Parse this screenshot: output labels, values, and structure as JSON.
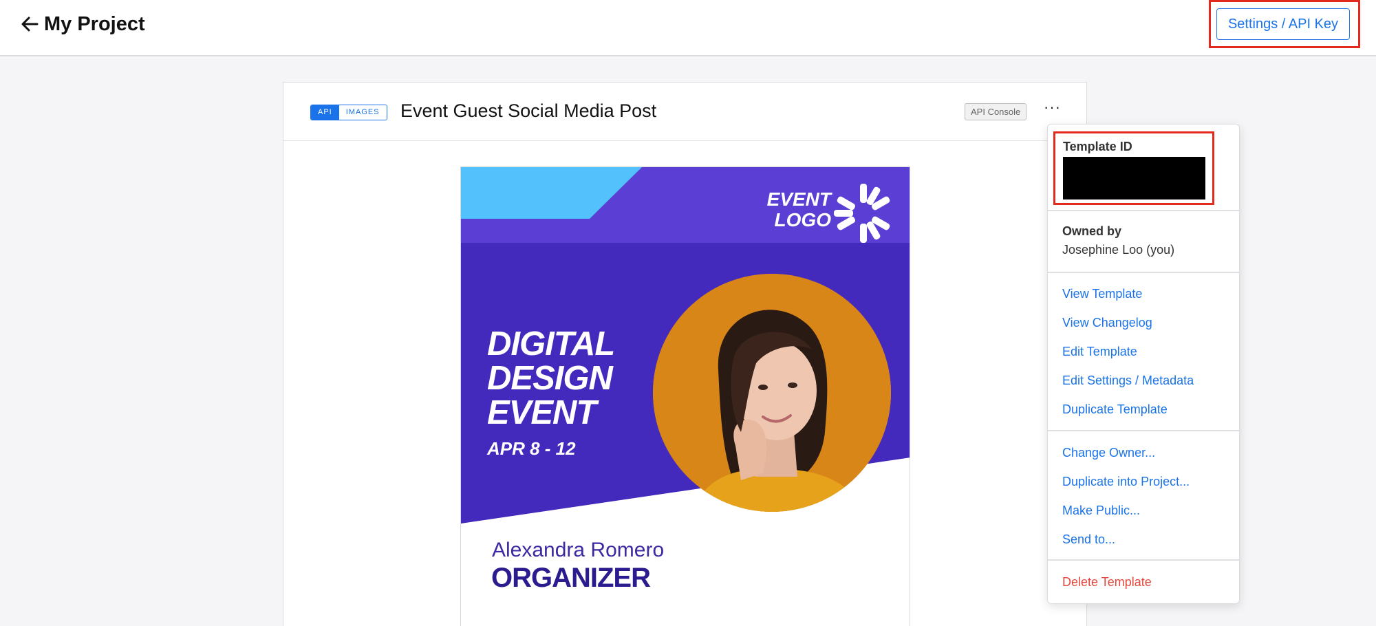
{
  "header": {
    "title": "My Project",
    "settings_label": "Settings / API Key"
  },
  "card": {
    "tag_api": "API",
    "tag_images": "IMAGES",
    "title": "Event Guest Social Media Post",
    "console_label": "API Console",
    "more_label": "···"
  },
  "preview": {
    "logo_line1": "EVENT",
    "logo_line2": "LOGO",
    "headline": "DIGITAL\nDESIGN\nEVENT",
    "dates": "APR 8 - 12",
    "name": "Alexandra Romero",
    "role": "ORGANIZER"
  },
  "menu": {
    "template_id_label": "Template ID",
    "owned_label": "Owned by",
    "owned_value": "Josephine Loo (you)",
    "items": [
      {
        "label": "View Template"
      },
      {
        "label": "View Changelog"
      },
      {
        "label": "Edit Template"
      },
      {
        "label": "Edit Settings / Metadata"
      },
      {
        "label": "Duplicate Template"
      },
      {
        "label": "Change Owner..."
      },
      {
        "label": "Duplicate into Project..."
      },
      {
        "label": "Make Public..."
      },
      {
        "label": "Send to..."
      },
      {
        "label": "Delete Template"
      }
    ]
  },
  "icons": {
    "back": "arrow-left-icon",
    "more": "more-horizontal-icon",
    "logo": "asterisk-logo-mark"
  },
  "colors": {
    "accent": "#1a73e8",
    "highlight": "#e32a1d",
    "danger": "#e5483c",
    "poster_purple": "#4429bd",
    "poster_cyan": "#53c1fb",
    "poster_orange": "#d98618"
  }
}
